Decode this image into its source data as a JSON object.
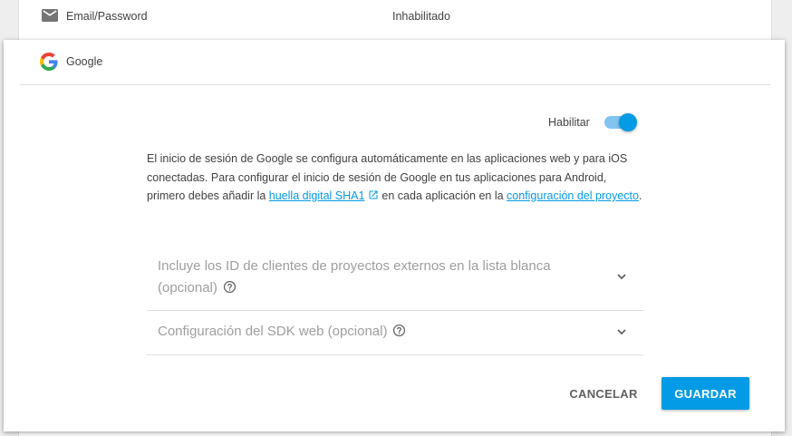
{
  "providers_list": {
    "email_row": {
      "name": "Email/Password",
      "status": "Inhabilitado",
      "icon": "email-icon"
    }
  },
  "google_panel": {
    "title": "Google",
    "icon": "google-logo",
    "enable": {
      "label": "Habilitar",
      "enabled": true,
      "accent": "#039be5"
    },
    "description": {
      "part1": "El inicio de sesión de Google se configura automáticamente en las aplicaciones web y para iOS conectadas. Para configurar el inicio de sesión de Google en tus aplicaciones para Android, primero debes añadir la ",
      "link1": "huella digital SHA1",
      "part2": "en cada aplicación en la ",
      "link2": "configuración del proyecto",
      "part3": "."
    },
    "sections": [
      {
        "label": "Incluye los ID de clientes de proyectos externos en la lista blanca (opcional)",
        "icon": "help-icon"
      },
      {
        "label": "Configuración del SDK web (opcional)",
        "icon": "help-icon"
      }
    ],
    "actions": {
      "cancel": "CANCELAR",
      "save": "GUARDAR"
    },
    "colors": {
      "link": "#039be5",
      "primary_button": "#039be5"
    }
  }
}
